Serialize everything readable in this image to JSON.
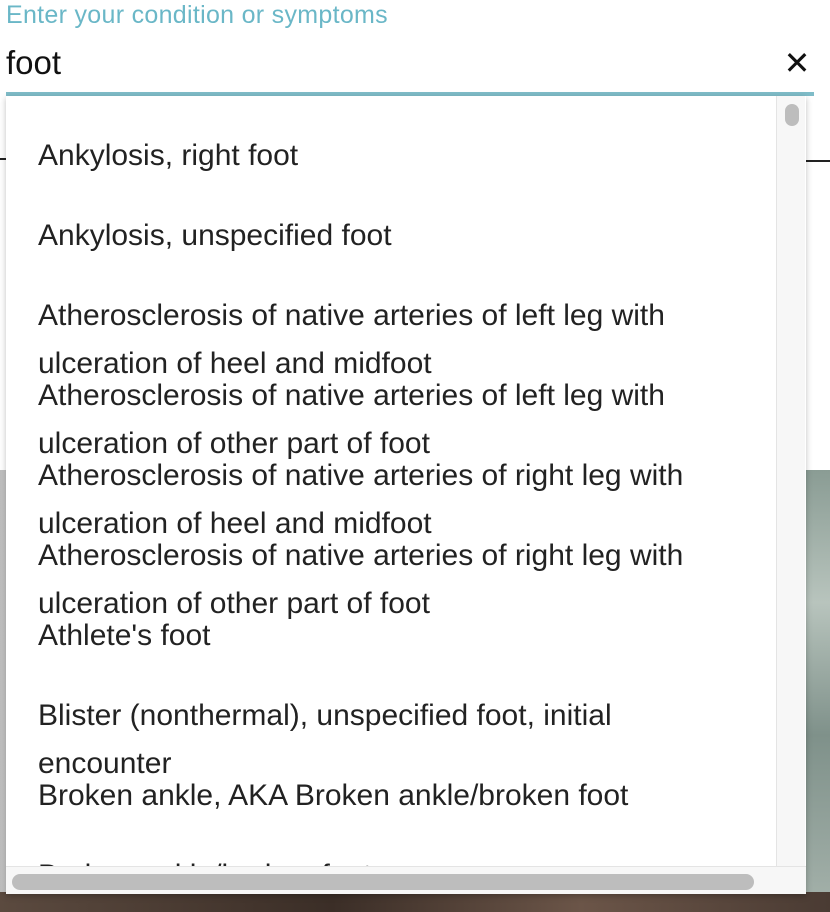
{
  "search": {
    "placeholder": "Enter your condition or symptoms",
    "value": "foot",
    "clear_icon": "close-icon"
  },
  "dropdown": {
    "items": [
      {
        "line1": "Ankylosis, right foot",
        "line2": ""
      },
      {
        "line1": "Ankylosis, unspecified foot",
        "line2": ""
      },
      {
        "line1": "Atherosclerosis of native arteries of left leg with",
        "line2": "ulceration of heel and midfoot"
      },
      {
        "line1": "Atherosclerosis of native arteries of left leg with",
        "line2": "ulceration of other part of foot"
      },
      {
        "line1": "Atherosclerosis of native arteries of right leg with",
        "line2": "ulceration of heel and midfoot"
      },
      {
        "line1": "Atherosclerosis of native arteries of right leg with",
        "line2": "ulceration of other part of foot"
      },
      {
        "line1": "Athlete's foot",
        "line2": ""
      },
      {
        "line1": "Blister (nonthermal), unspecified foot, initial",
        "line2": "encounter"
      },
      {
        "line1": "Broken ankle, AKA Broken ankle/broken foot",
        "line2": ""
      },
      {
        "line1": "Broken ankle/broken foot",
        "line2": ""
      }
    ]
  },
  "colors": {
    "accent": "#6ab7c7",
    "underline": "#7fbcc8",
    "text": "#222222"
  }
}
